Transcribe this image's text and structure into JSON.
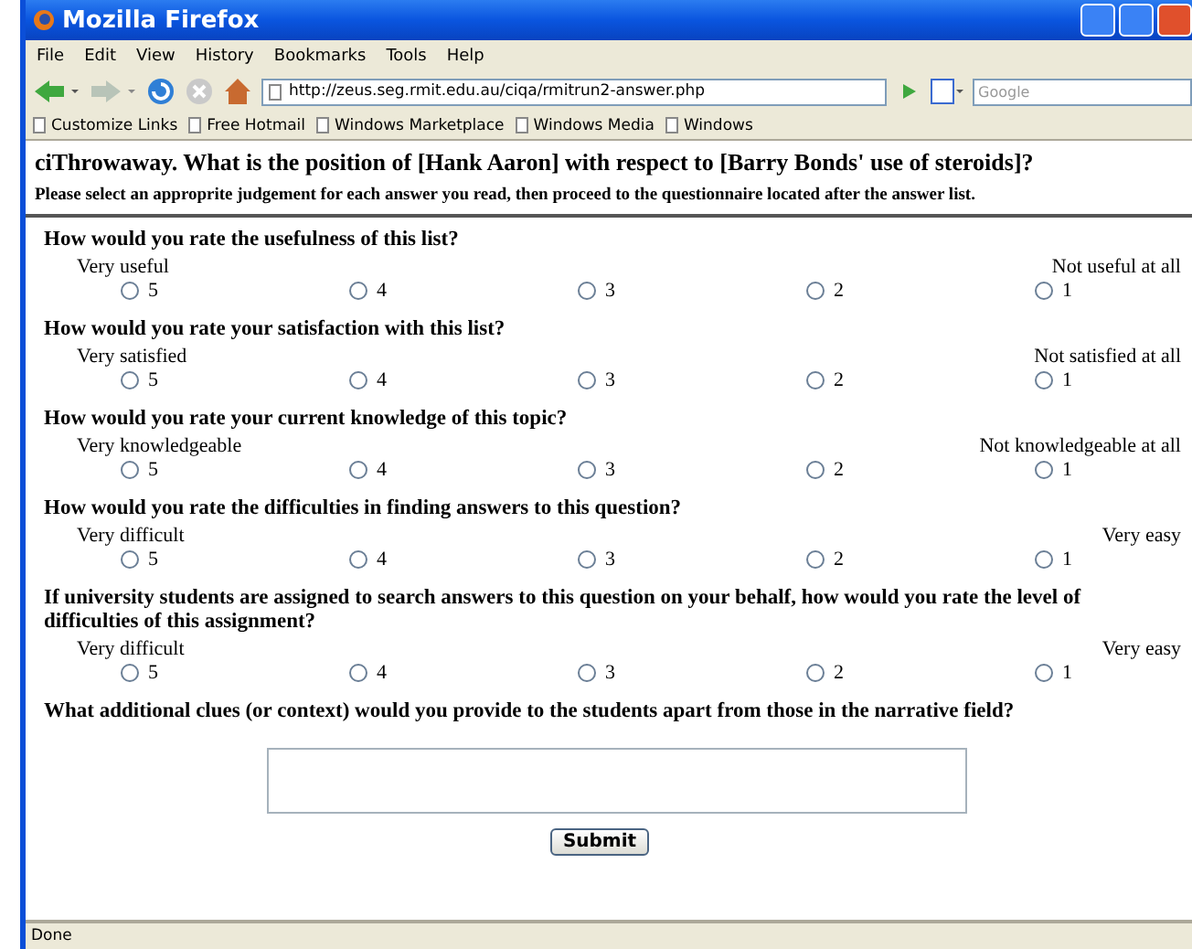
{
  "window": {
    "title": "Mozilla Firefox"
  },
  "menu": [
    "File",
    "Edit",
    "View",
    "History",
    "Bookmarks",
    "Tools",
    "Help"
  ],
  "address_bar": {
    "value": "http://zeus.seg.rmit.edu.au/ciqa/rmitrun2-answer.php"
  },
  "search": {
    "placeholder": "Google"
  },
  "bookmarks": [
    "Customize Links",
    "Free Hotmail",
    "Windows Marketplace",
    "Windows Media",
    "Windows"
  ],
  "page": {
    "heading": "ciThrowaway. What is the position of [Hank Aaron] with respect to [Barry Bonds' use of steroids]?",
    "instructions": "Please select an approprite judgement for each answer you read, then proceed to the questionnaire located after the answer list.",
    "questions": [
      {
        "question": "How would you rate the usefulness of this list?",
        "low_label": "Very useful",
        "high_label": "Not useful at all",
        "options": [
          {
            "label": "5",
            "selected": false
          },
          {
            "label": "4",
            "selected": false
          },
          {
            "label": "3",
            "selected": false
          },
          {
            "label": "2",
            "selected": false
          },
          {
            "label": "1",
            "selected": false
          }
        ]
      },
      {
        "question": "How would you rate your satisfaction with this list?",
        "low_label": "Very satisfied",
        "high_label": "Not satisfied at all",
        "options": [
          {
            "label": "5",
            "selected": false
          },
          {
            "label": "4",
            "selected": false
          },
          {
            "label": "3",
            "selected": false
          },
          {
            "label": "2",
            "selected": false
          },
          {
            "label": "1",
            "selected": false
          }
        ]
      },
      {
        "question": "How would you rate your current knowledge of this topic?",
        "low_label": "Very knowledgeable",
        "high_label": "Not knowledgeable at all",
        "options": [
          {
            "label": "5",
            "selected": false
          },
          {
            "label": "4",
            "selected": false
          },
          {
            "label": "3",
            "selected": false
          },
          {
            "label": "2",
            "selected": false
          },
          {
            "label": "1",
            "selected": false
          }
        ]
      },
      {
        "question": "How would you rate the difficulties in finding answers to this question?",
        "low_label": "Very difficult",
        "high_label": "Very easy",
        "options": [
          {
            "label": "5",
            "selected": false
          },
          {
            "label": "4",
            "selected": false
          },
          {
            "label": "3",
            "selected": false
          },
          {
            "label": "2",
            "selected": false
          },
          {
            "label": "1",
            "selected": false
          }
        ]
      },
      {
        "question": "If university students are assigned to search answers to this question on your behalf, how would you rate the level of difficulties of this assignment?",
        "low_label": "Very difficult",
        "high_label": "Very easy",
        "options": [
          {
            "label": "5",
            "selected": false
          },
          {
            "label": "4",
            "selected": false
          },
          {
            "label": "3",
            "selected": false
          },
          {
            "label": "2",
            "selected": false
          },
          {
            "label": "1",
            "selected": false
          }
        ]
      }
    ],
    "clues_question": "What additional clues (or context) would you provide to the students apart from those in the narrative field?",
    "submit": "Submit"
  },
  "status_bar": "Done"
}
